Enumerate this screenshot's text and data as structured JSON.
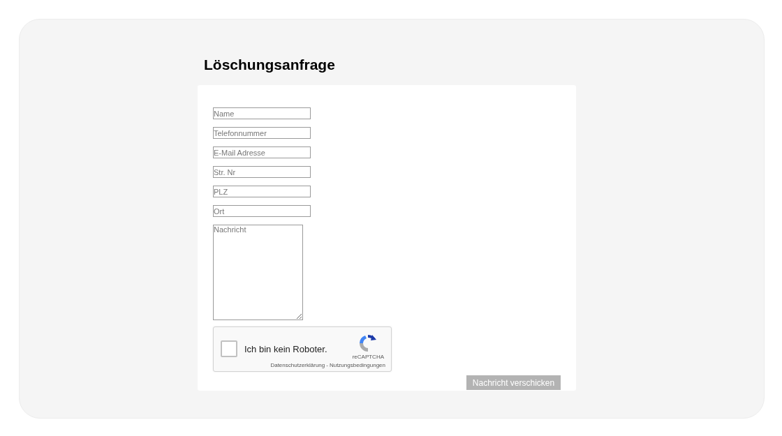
{
  "title": "Löschungsanfrage",
  "fields": [
    {
      "placeholder": "Name"
    },
    {
      "placeholder": "Telefonnummer"
    },
    {
      "placeholder": "E-Mail Adresse"
    },
    {
      "placeholder": "Str. Nr"
    },
    {
      "placeholder": "PLZ"
    },
    {
      "placeholder": "Ort"
    }
  ],
  "message": {
    "placeholder": "Nachricht"
  },
  "captcha": {
    "label": "Ich bin kein Roboter.",
    "checked": false,
    "brand": "reCAPTCHA",
    "privacy": "Datenschutzerklärung",
    "separator": "-",
    "terms": "Nutzungsbedingungen"
  },
  "submit": {
    "label": "Nachricht verschicken",
    "disabled": true
  }
}
